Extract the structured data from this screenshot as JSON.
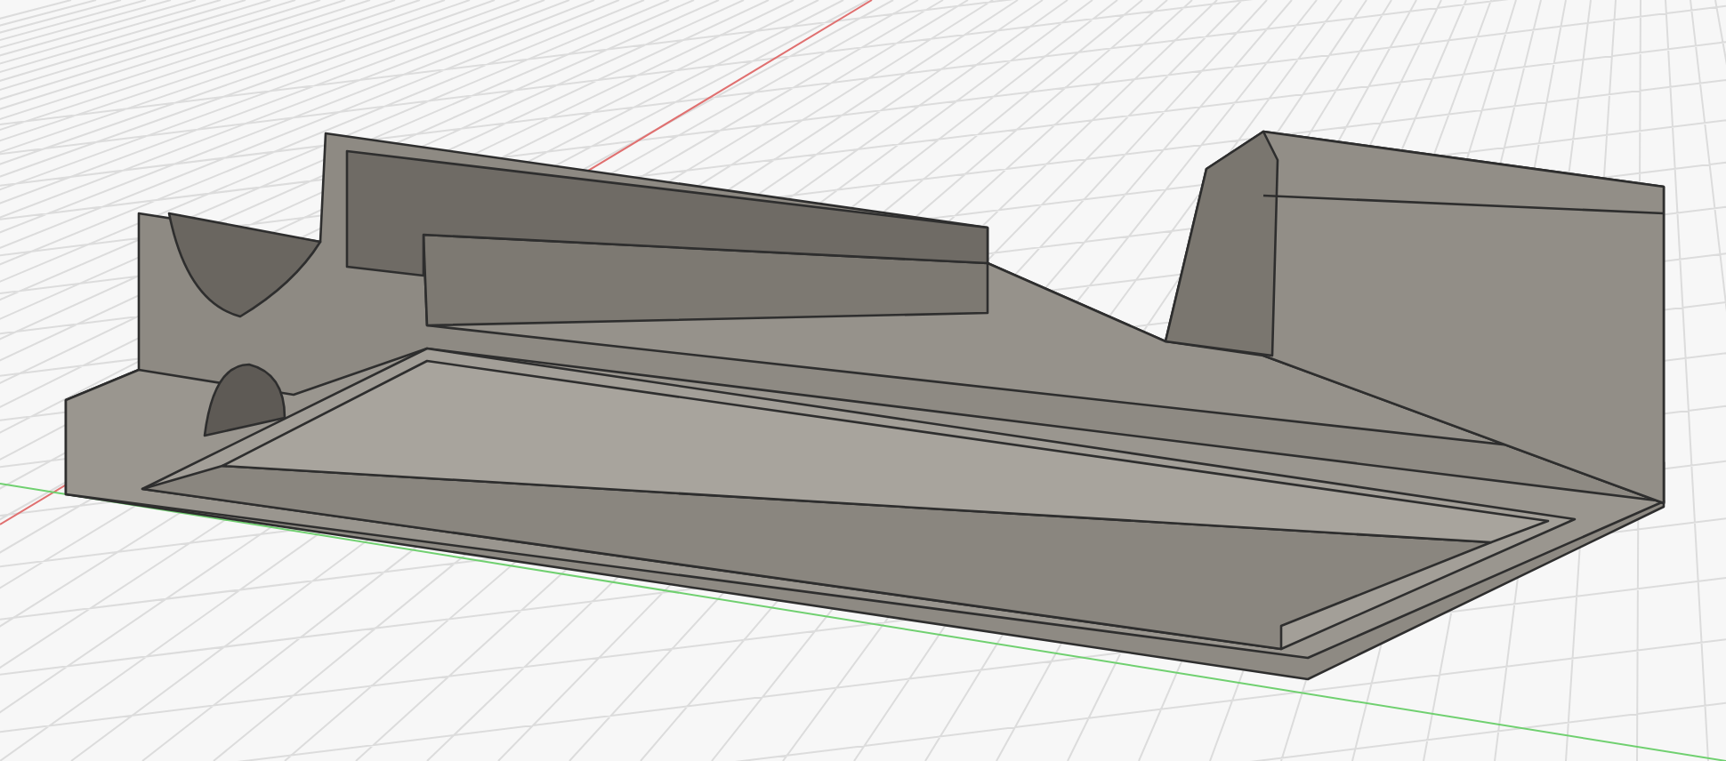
{
  "viewport": {
    "axes": [
      {
        "kind": "x",
        "color": "#e07070"
      },
      {
        "kind": "y",
        "color": "#70d070"
      }
    ]
  }
}
